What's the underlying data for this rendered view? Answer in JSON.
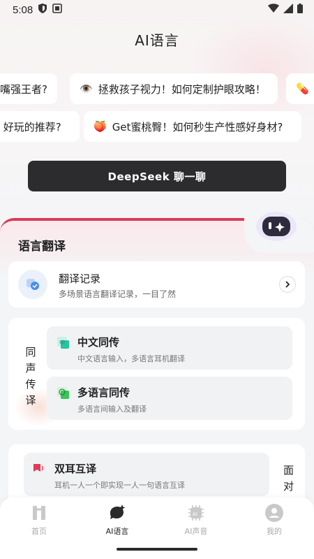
{
  "status_bar": {
    "time": "5:08"
  },
  "header": {
    "title": "AI语言"
  },
  "suggestions": {
    "row1": [
      {
        "emoji": "",
        "text": "嘴强王者?"
      },
      {
        "emoji": "👁️",
        "text": "拯救孩子视力！如何定制护眼攻略！"
      },
      {
        "emoji": "💊",
        "text": ""
      }
    ],
    "row2": [
      {
        "emoji": "",
        "text": " 好玩的推荐?"
      },
      {
        "emoji": "🍑",
        "text": "Get蜜桃臀！如何秒生产性感好身材?"
      }
    ]
  },
  "deepseek_button": {
    "label": "DeepSeek 聊一聊"
  },
  "translate_section": {
    "title": "语言翻译",
    "record": {
      "title": "翻译记录",
      "subtitle": "多场景语言翻译记录，一目了然"
    },
    "simultaneous": {
      "side_label": [
        "同",
        "声",
        "传",
        "译"
      ],
      "chinese": {
        "title": "中文同传",
        "desc": "中文语言输入，多语言耳机翻译"
      },
      "multi": {
        "title": "多语言同传",
        "desc": "多语言间输入及翻译"
      }
    },
    "dual_ear": {
      "title": "双耳互译",
      "desc": "耳机一人一个即实现一人一句语言互译",
      "side_label": [
        "面",
        "对"
      ]
    }
  },
  "tabbar": {
    "items": [
      {
        "label": "首页",
        "active": false
      },
      {
        "label": "AI语言",
        "active": true
      },
      {
        "label": "AI声音",
        "active": false
      },
      {
        "label": "我的",
        "active": false
      }
    ]
  },
  "colors": {
    "accent": "#d83d57",
    "button_dark": "#2c2c2e"
  }
}
